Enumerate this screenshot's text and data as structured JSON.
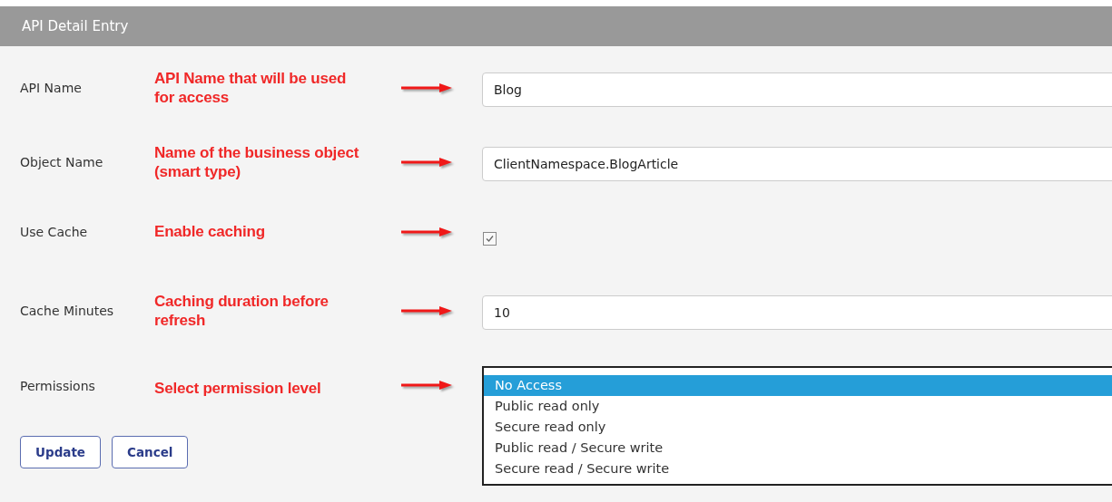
{
  "panel": {
    "title": "API Detail Entry"
  },
  "fields": [
    {
      "kind": "text",
      "label": "API Name",
      "annotation": "API Name that will be used for access",
      "value": "Blog"
    },
    {
      "kind": "text",
      "label": "Object Name",
      "annotation": "Name of the business object (smart type)",
      "value": "ClientNamespace.BlogArticle"
    },
    {
      "kind": "checkbox",
      "label": "Use Cache",
      "annotation": "Enable caching",
      "checked": true
    },
    {
      "kind": "text",
      "label": "Cache Minutes",
      "annotation": "Caching duration before refresh",
      "value": "10"
    },
    {
      "kind": "listbox",
      "label": "Permissions",
      "annotation": "Select permission level",
      "options": [
        {
          "label": "No Access",
          "selected": true
        },
        {
          "label": "Public read only",
          "selected": false
        },
        {
          "label": "Secure read only",
          "selected": false
        },
        {
          "label": "Public read / Secure write",
          "selected": false
        },
        {
          "label": "Secure read / Secure write",
          "selected": false
        }
      ]
    }
  ],
  "buttons": [
    "Update",
    "Cancel"
  ]
}
